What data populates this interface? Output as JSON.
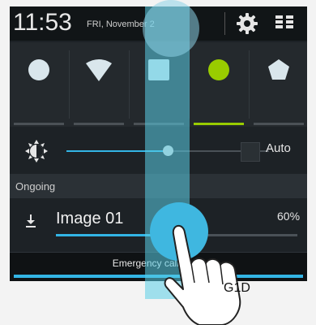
{
  "status_bar": {
    "time": "11:53",
    "date": "FRI, November 2",
    "settings_icon": "gear-icon",
    "toggles_icon": "quick-settings-grid-icon"
  },
  "quick_settings": {
    "tiles": [
      {
        "icon": "circle-icon",
        "active": false
      },
      {
        "icon": "wifi-icon",
        "active": false
      },
      {
        "icon": "square-icon",
        "active": false
      },
      {
        "icon": "circle-icon",
        "active": true,
        "color": "#99cc00"
      },
      {
        "icon": "pentagon-icon",
        "active": false
      }
    ]
  },
  "brightness": {
    "icon": "brightness-sun-icon",
    "level": 0.5,
    "auto_label": "Auto"
  },
  "ongoing": {
    "header": "Ongoing"
  },
  "notification": {
    "icon": "download-icon",
    "title": "Image 01",
    "percent_text": "60%",
    "progress": 0.6
  },
  "emergency": {
    "label": "Emergency calls only"
  },
  "gesture": {
    "label": "G1D"
  },
  "colors": {
    "accent": "#33b5e5",
    "active_tile": "#99cc00",
    "panel_bg": "#1d2226"
  }
}
